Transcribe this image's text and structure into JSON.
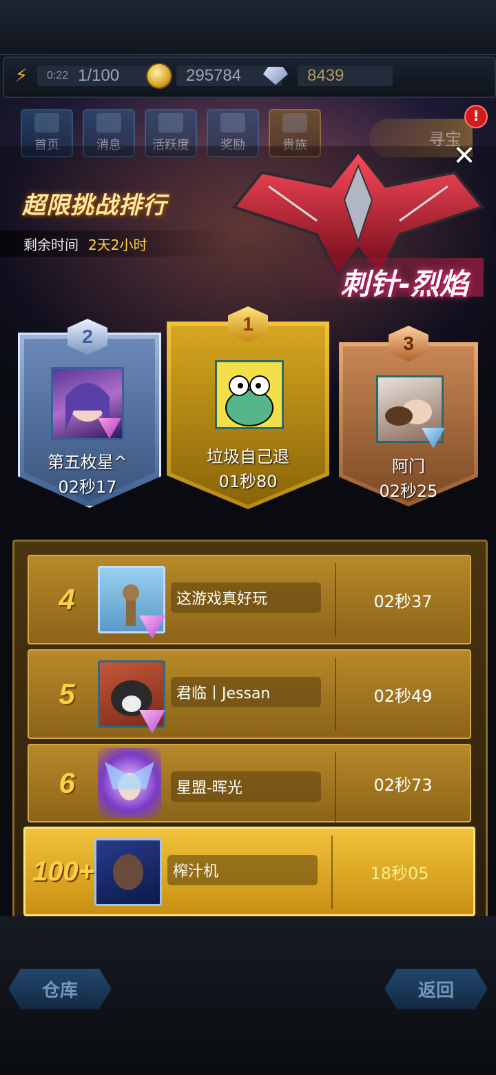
{
  "resources": {
    "energy_timer": "0:22",
    "energy": "1/100",
    "coins": "295784",
    "gems": "8439"
  },
  "nav": {
    "home": "首页",
    "messages": "消息",
    "activity": "活跃度",
    "rewards": "奖励",
    "noble": "贵族",
    "treasure": "寻宝",
    "badge": "!"
  },
  "event": {
    "title": "超限挑战排行",
    "time_label": "剩余时间",
    "time_value": "2天2小时",
    "ship_name": "刺针-烈焰",
    "close_icon": "close-icon"
  },
  "podium": [
    {
      "rank": "1",
      "name": "垃圾自己退",
      "time": "01秒80"
    },
    {
      "rank": "2",
      "name": "第五枚星^",
      "time": "02秒17"
    },
    {
      "rank": "3",
      "name": "阿门",
      "time": "02秒25"
    }
  ],
  "ranking": [
    {
      "rank": "4",
      "name": "这游戏真好玩",
      "time": "02秒37"
    },
    {
      "rank": "5",
      "name": "君临丨Jessan",
      "time": "02秒49"
    },
    {
      "rank": "6",
      "name": "星盟-晖光",
      "time": "02秒73"
    }
  ],
  "me": {
    "rank": "100+",
    "name": "榨汁机",
    "time": "18秒05"
  },
  "footer": {
    "warehouse": "仓库",
    "back": "返回"
  },
  "colors": {
    "gold": "#f1c23c",
    "silver": "#9fb6d9",
    "bronze": "#e8a872",
    "accent": "#ffd54a"
  }
}
